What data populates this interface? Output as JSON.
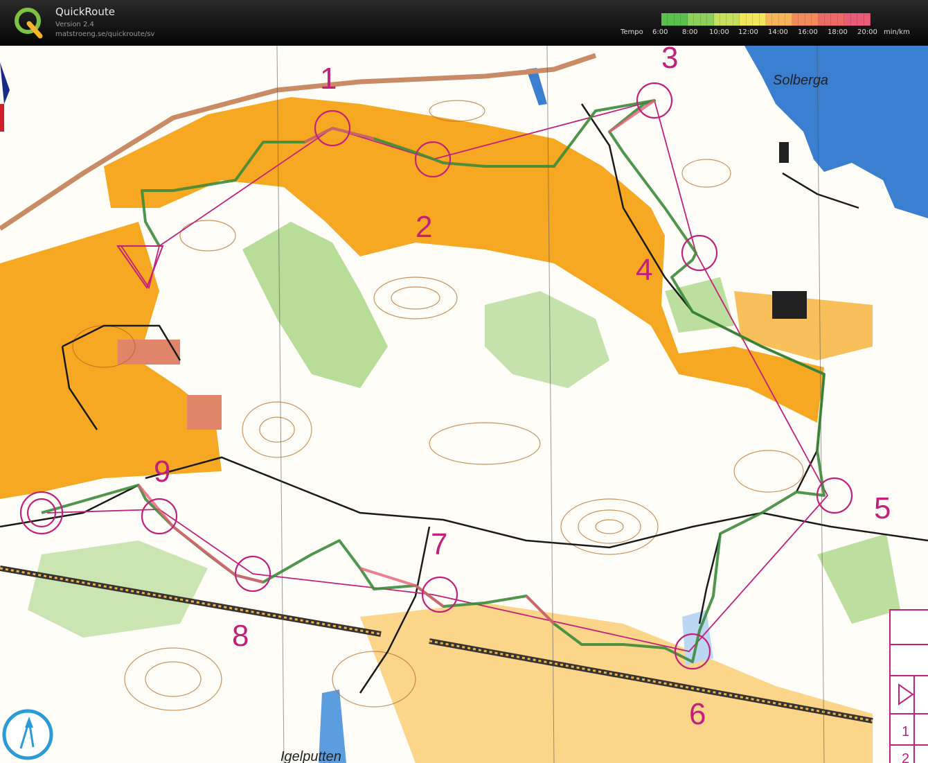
{
  "app": {
    "title": "QuickRoute",
    "version": "Version 2.4",
    "url": "matstroeng.se/quickroute/sv"
  },
  "tempo_legend": {
    "label": "Tempo",
    "ticks": [
      "6:00",
      "8:00",
      "10:00",
      "12:00",
      "14:00",
      "16:00",
      "18:00",
      "20:00"
    ],
    "unit": "min/km",
    "colors": [
      "#5bbf4f",
      "#8fd05a",
      "#c6e05c",
      "#f2e65a",
      "#f7b45a",
      "#f28a5a",
      "#ec6a66",
      "#e85c78"
    ]
  },
  "map": {
    "place_names": {
      "solberga": "Solberga",
      "igelputten": "Igelputten"
    },
    "controls": [
      {
        "id": "start",
        "label": ""
      },
      {
        "id": "c1",
        "label": "1"
      },
      {
        "id": "c2",
        "label": "2"
      },
      {
        "id": "c3",
        "label": "3"
      },
      {
        "id": "c4",
        "label": "4"
      },
      {
        "id": "c5",
        "label": "5"
      },
      {
        "id": "c6",
        "label": "6"
      },
      {
        "id": "c7",
        "label": "7"
      },
      {
        "id": "c8",
        "label": "8"
      },
      {
        "id": "c9",
        "label": "9"
      },
      {
        "id": "finish",
        "label": ""
      }
    ],
    "description_sheet": {
      "row_labels": [
        "1",
        "2"
      ]
    },
    "colors": {
      "course": "#c2207a",
      "route_track": "#3c8a3a",
      "open_land": "#f7a823",
      "water": "#3b7fd0",
      "vegetation": "#9fd17a",
      "contour": "#b5651d"
    }
  }
}
